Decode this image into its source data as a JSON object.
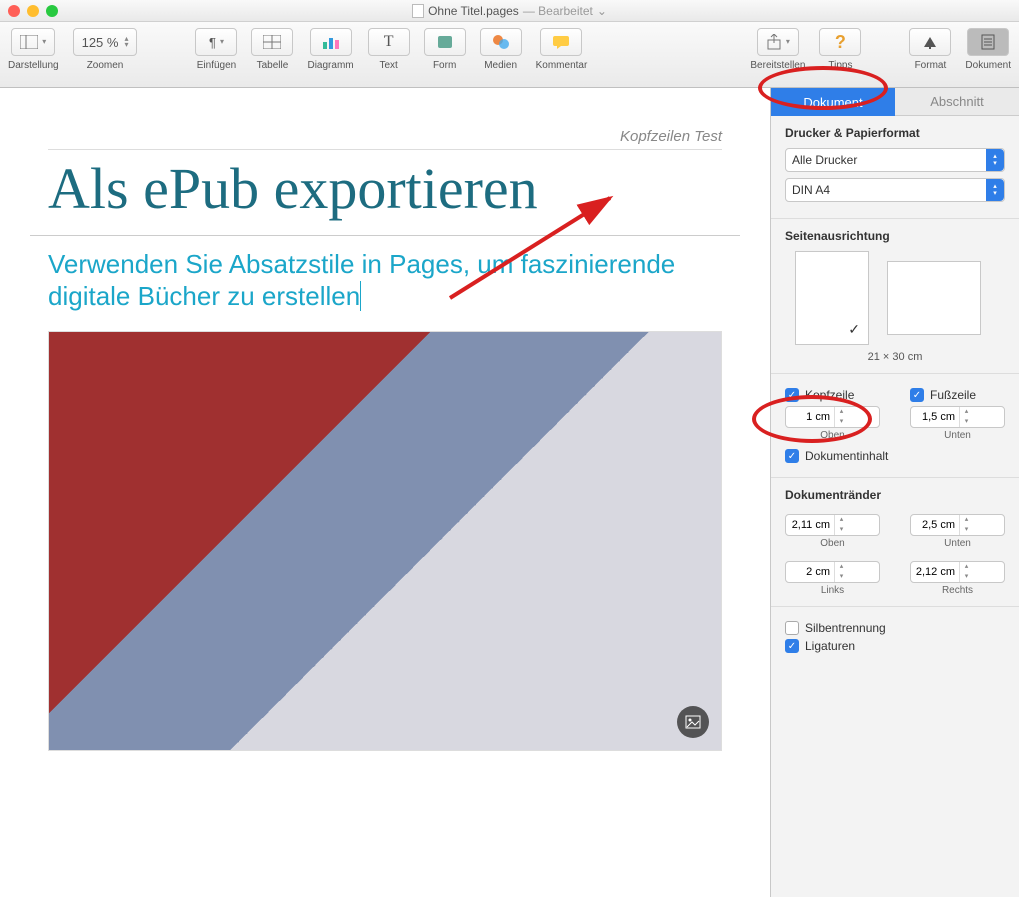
{
  "title": {
    "filename": "Ohne Titel.pages",
    "status": "— Bearbeitet",
    "chevron": "⌄"
  },
  "toolbar": {
    "darstellung": "Darstellung",
    "zoomen": "Zoomen",
    "zoom_value": "125 %",
    "einfuegen": "Einfügen",
    "tabelle": "Tabelle",
    "diagramm": "Diagramm",
    "text": "Text",
    "form": "Form",
    "medien": "Medien",
    "kommentar": "Kommentar",
    "bereitstellen": "Bereitstellen",
    "tipps": "Tipps",
    "format": "Format",
    "dokument": "Dokument"
  },
  "doc": {
    "header": "Kopfzeilen Test",
    "title": "Als ePub exportieren",
    "subtitle": "Verwenden Sie Absatzstile in Pages, um faszinierende digitale Bücher zu erstellen"
  },
  "sidebar": {
    "tab_dokument": "Dokument",
    "tab_abschnitt": "Abschnitt",
    "printer_section": "Drucker & Papierformat",
    "printer": "Alle Drucker",
    "paper": "DIN A4",
    "orient_section": "Seitenausrichtung",
    "orient_size": "21 × 30 cm",
    "kopfzeile": "Kopfzeile",
    "fusszeile": "Fußzeile",
    "top_val": "1 cm",
    "bot_val": "1,5 cm",
    "oben": "Oben",
    "unten": "Unten",
    "dokinhalt": "Dokumentinhalt",
    "margins_h": "Dokumentränder",
    "m_oben": "2,11 cm",
    "m_unten": "2,5 cm",
    "m_links": "2 cm",
    "m_rechts": "2,12 cm",
    "links": "Links",
    "rechts": "Rechts",
    "silben": "Silbentrennung",
    "liga": "Ligaturen"
  }
}
